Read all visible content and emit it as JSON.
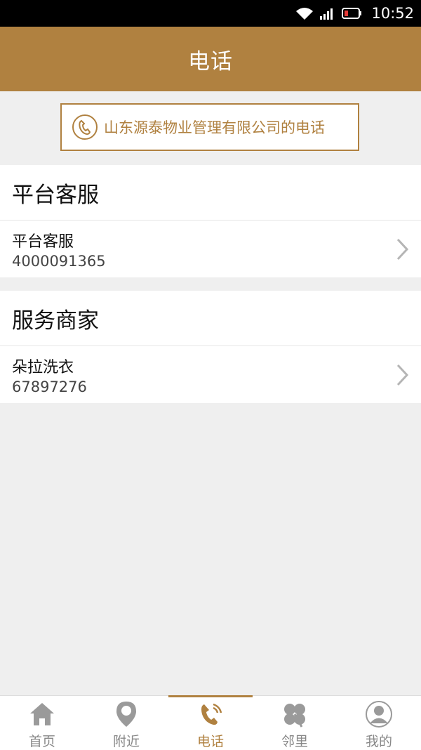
{
  "status_bar": {
    "time": "10:52"
  },
  "header": {
    "title": "电话"
  },
  "banner": {
    "text": "山东源泰物业管理有限公司的电话"
  },
  "sections": [
    {
      "title": "平台客服",
      "items": [
        {
          "name": "平台客服",
          "phone": "4000091365"
        }
      ]
    },
    {
      "title": "服务商家",
      "items": [
        {
          "name": "朵拉洗衣",
          "phone": "67897276"
        }
      ]
    }
  ],
  "tabs": [
    {
      "label": "首页",
      "icon": "home-icon",
      "active": false
    },
    {
      "label": "附近",
      "icon": "location-pin-icon",
      "active": false
    },
    {
      "label": "电话",
      "icon": "phone-icon",
      "active": true
    },
    {
      "label": "邻里",
      "icon": "clover-icon",
      "active": false
    },
    {
      "label": "我的",
      "icon": "user-icon",
      "active": false
    }
  ],
  "colors": {
    "accent": "#b08140",
    "background": "#efefef",
    "inactive_tab": "#888888"
  }
}
